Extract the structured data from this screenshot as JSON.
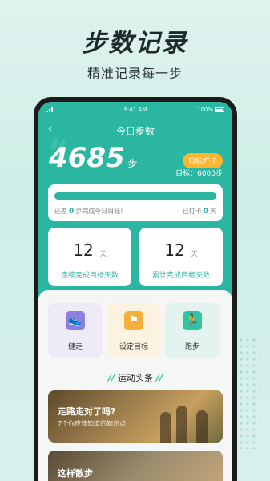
{
  "promo": {
    "title": "步数记录",
    "subtitle": "精准记录每一步"
  },
  "status": {
    "time": "9:41 AM",
    "battery": "100%"
  },
  "nav": {
    "back_icon": "‹",
    "title": "今日步数"
  },
  "today": {
    "steps": "4685",
    "unit": "步",
    "checkin_label": "目标打卡",
    "goal_text": "目标：6000步"
  },
  "progress": {
    "fraction": 1.0,
    "left_prefix": "还差",
    "left_value": "0",
    "left_suffix": "步完成今日目标!",
    "right_prefix": "已打卡",
    "right_value": "0",
    "right_suffix": "天"
  },
  "stats": [
    {
      "value": "12",
      "unit": "天",
      "label": "连续完成目标天数"
    },
    {
      "value": "12",
      "unit": "天",
      "label": "累计完成目标天数"
    }
  ],
  "functions": [
    {
      "label": "健走",
      "icon": "walk-icon"
    },
    {
      "label": "设定目标",
      "icon": "target-icon"
    },
    {
      "label": "跑步",
      "icon": "run-icon"
    }
  ],
  "section": {
    "title": "运动头条"
  },
  "news": [
    {
      "title": "走路走对了吗?",
      "subtitle": "7个你应该知道的知识点"
    },
    {
      "title": "这样散步",
      "subtitle": ""
    }
  ],
  "colors": {
    "accent": "#2ab6a0",
    "checkin": "#ffb534"
  }
}
